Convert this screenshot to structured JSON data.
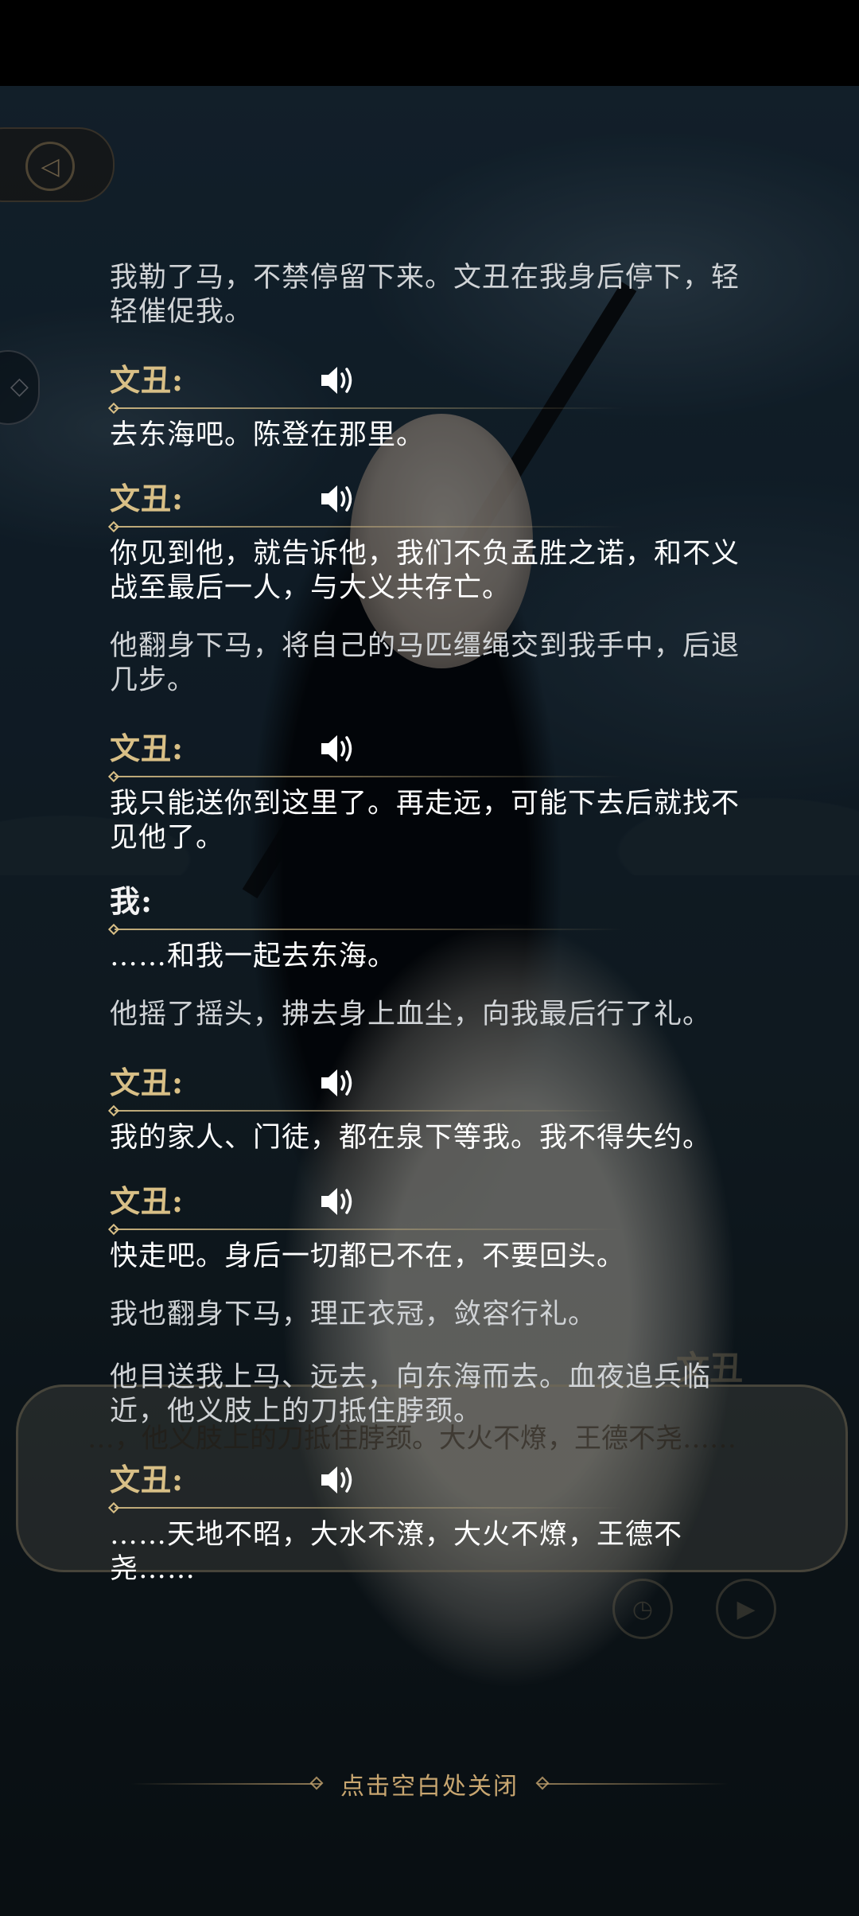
{
  "status_bar": {},
  "hud": {
    "back_icon": "back-arrow-icon",
    "side_icon": "diamond-icon",
    "dialog_name": "文丑",
    "dialog_text": "…，他义肢上的刀抵住脖颈。大火不燎，王德不尧……",
    "history_icon": "clock-icon",
    "auto_play_icon": "play-icon"
  },
  "log": {
    "voice_icon": "speaker-icon",
    "entries": [
      {
        "type": "narration",
        "text": "我勒了马，不禁停留下来。文丑在我身后停下，轻轻催促我。"
      },
      {
        "type": "line",
        "speaker": "文丑:",
        "text": "去东海吧。陈登在那里。",
        "voice": true
      },
      {
        "type": "line",
        "speaker": "文丑:",
        "text": "你见到他，就告诉他，我们不负孟胜之诺，和不义战至最后一人，与大义共存亡。",
        "voice": true
      },
      {
        "type": "narration",
        "text": "他翻身下马，将自己的马匹缰绳交到我手中，后退几步。"
      },
      {
        "type": "line",
        "speaker": "文丑:",
        "text": "我只能送你到这里了。再走远，可能下去后就找不见他了。",
        "voice": true
      },
      {
        "type": "line",
        "speaker": "我:",
        "text": "……和我一起去东海。",
        "voice": false
      },
      {
        "type": "narration",
        "text": "他摇了摇头，拂去身上血尘，向我最后行了礼。"
      },
      {
        "type": "line",
        "speaker": "文丑:",
        "text": "我的家人、门徒，都在泉下等我。我不得失约。",
        "voice": true
      },
      {
        "type": "line",
        "speaker": "文丑:",
        "text": "快走吧。身后一切都已不在，不要回头。",
        "voice": true
      },
      {
        "type": "narration",
        "text": "我也翻身下马，理正衣冠，敛容行礼。"
      },
      {
        "type": "narration",
        "text": "他目送我上马、远去，向东海而去。血夜追兵临近，他义肢上的刀抵住脖颈。"
      },
      {
        "type": "line",
        "speaker": "文丑:",
        "text": "……天地不昭，大水不潦，大火不燎，王德不尧……",
        "voice": true
      }
    ]
  },
  "close_hint": "点击空白处关闭"
}
